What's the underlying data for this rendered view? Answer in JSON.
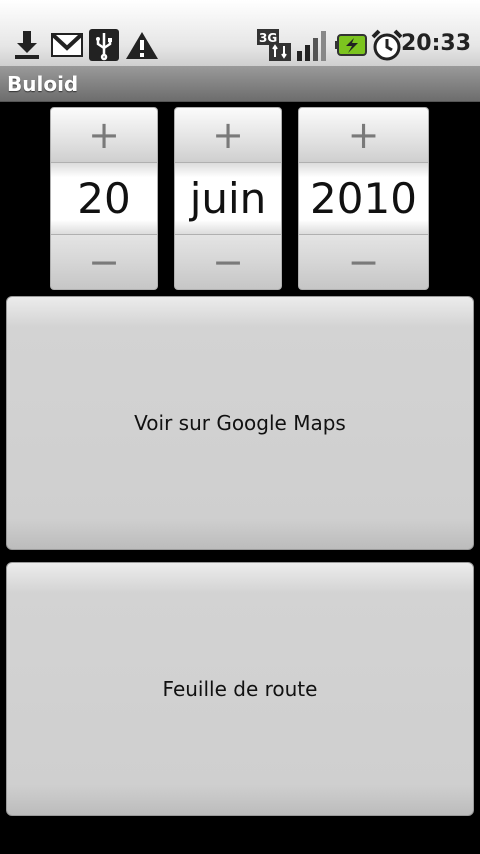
{
  "status_bar": {
    "time": "20:33",
    "icons": [
      "download-icon",
      "gmail-icon",
      "usb-icon",
      "warning-icon",
      "3g-icon",
      "signal-icon",
      "battery-charging-icon",
      "alarm-icon"
    ],
    "network_label": "3G",
    "accent_green": "#7cc41f"
  },
  "app": {
    "title": "Buloid"
  },
  "date_picker": {
    "increment_label": "+",
    "decrement_label": "−",
    "day": "20",
    "month": "juin",
    "year": "2010"
  },
  "buttons": {
    "maps_label": "Voir sur Google Maps",
    "route_label": "Feuille de route"
  }
}
